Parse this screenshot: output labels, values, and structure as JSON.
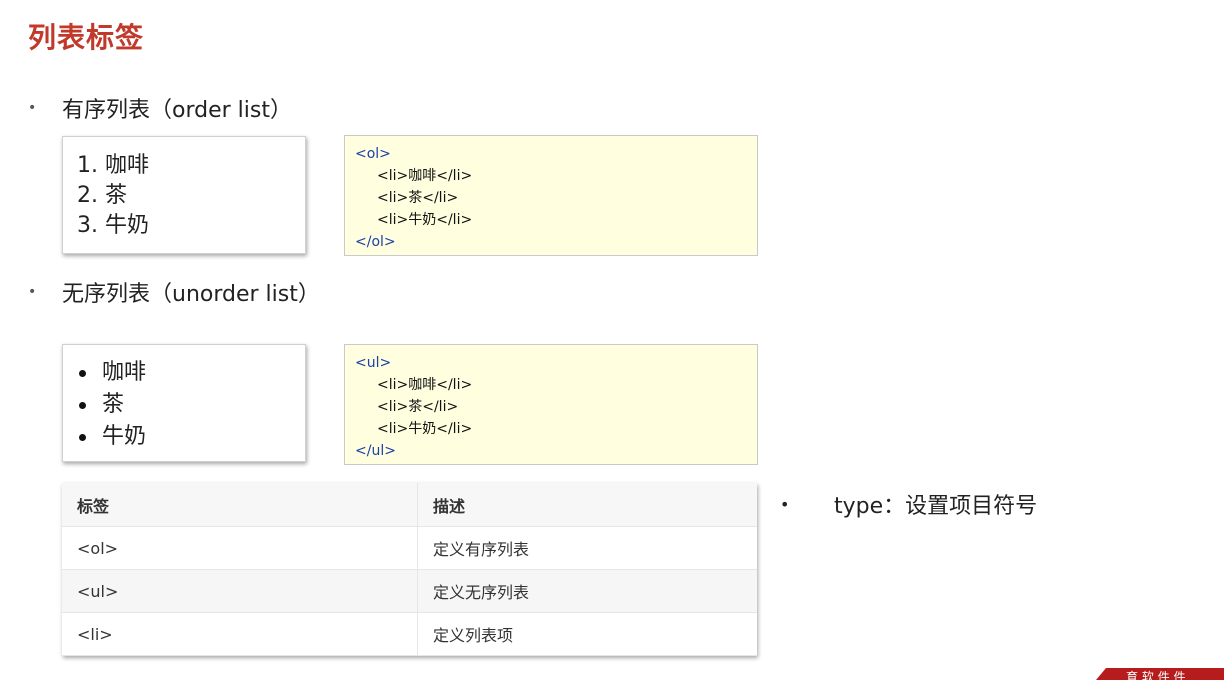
{
  "slide": {
    "title": "列表标签"
  },
  "ordered": {
    "bullet": "•",
    "heading": "有序列表（order list）",
    "demo_items": [
      "1. 咖啡",
      "2. 茶",
      "3. 牛奶"
    ],
    "code": {
      "open": "<ol>",
      "items": [
        "<li>咖啡</li>",
        "<li>茶</li>",
        "<li>牛奶</li>"
      ],
      "close": "</ol>"
    }
  },
  "unordered": {
    "bullet": "•",
    "heading": "无序列表（unorder list）",
    "demo_items": [
      "咖啡",
      "茶",
      "牛奶"
    ],
    "code": {
      "open": "<ul>",
      "items": [
        "<li>咖啡</li>",
        "<li>茶</li>",
        "<li>牛奶</li>"
      ],
      "close": "</ul>"
    }
  },
  "table": {
    "headers": [
      "标签",
      "描述"
    ],
    "rows": [
      [
        "<ol>",
        "定义有序列表"
      ],
      [
        "<ul>",
        "定义无序列表"
      ],
      [
        "<li>",
        "定义列表项"
      ]
    ]
  },
  "note": {
    "bullet": "•",
    "text": "type：设置项目符号"
  },
  "banner": {
    "text": "育 软 件 件"
  },
  "colors": {
    "title": "#c0392b",
    "code_bg": "#ffffe0",
    "tag": "#1a3fa8",
    "banner": "#b71c1c"
  }
}
